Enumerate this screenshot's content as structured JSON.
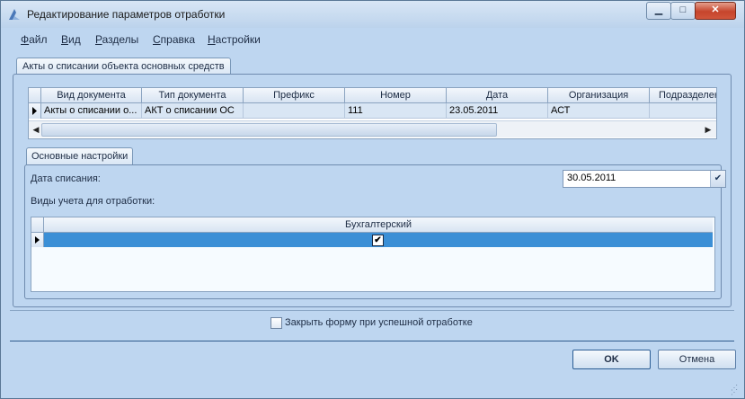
{
  "window": {
    "title": "Редактирование параметров отработки"
  },
  "menu": [
    {
      "u": "Ф",
      "rest": "айл"
    },
    {
      "u": "В",
      "rest": "ид"
    },
    {
      "u": "Р",
      "rest": "азделы"
    },
    {
      "u": "С",
      "rest": "правка"
    },
    {
      "u": "Н",
      "rest": "астройки"
    }
  ],
  "outer_tab": "Акты о списании объекта основных средств",
  "doc_grid": {
    "columns": [
      "Вид документа",
      "Тип документа",
      "Префикс",
      "Номер",
      "Дата",
      "Организация",
      "Подразделение"
    ],
    "row": [
      "Акты о списании о...",
      "АКТ о списании ОС",
      "",
      "111",
      "23.05.2011",
      "АСТ",
      ""
    ]
  },
  "inner_tab": "Основные настройки",
  "settings": {
    "date_label": "Дата списания:",
    "date_value": "30.05.2011",
    "accounting_label": "Виды учета для отработки:",
    "accounting_column": "Бухгалтерский",
    "accounting_checked": true
  },
  "close_on_success_label": "Закрыть форму при успешной отработке",
  "close_on_success_checked": false,
  "buttons": {
    "ok": "OK",
    "cancel": "Отмена"
  }
}
